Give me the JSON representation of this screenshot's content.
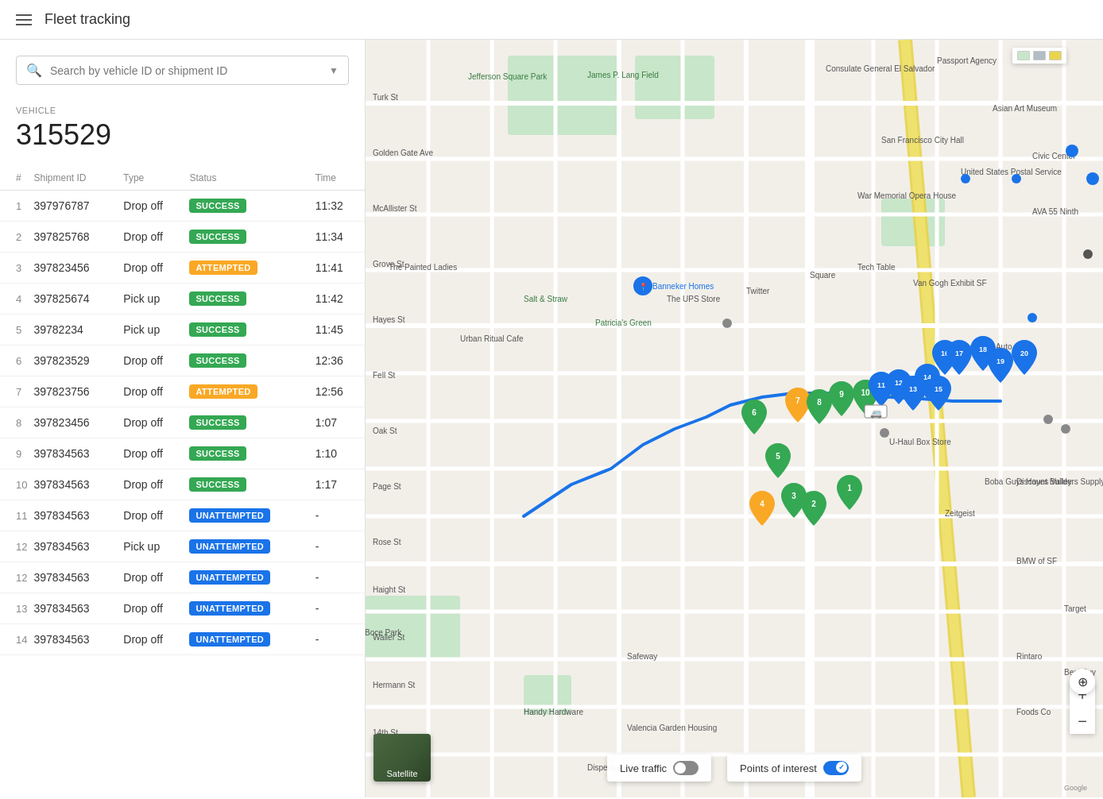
{
  "header": {
    "title": "Fleet tracking",
    "menu_icon_label": "Menu"
  },
  "search": {
    "placeholder": "Search by vehicle ID or shipment ID"
  },
  "vehicle": {
    "label": "VEHICLE",
    "id": "315529"
  },
  "table": {
    "columns": [
      "#",
      "Shipment ID",
      "Type",
      "Status",
      "Time"
    ],
    "rows": [
      {
        "num": 1,
        "shipment_id": "397976787",
        "type": "Drop off",
        "status": "SUCCESS",
        "time": "11:32"
      },
      {
        "num": 2,
        "shipment_id": "397825768",
        "type": "Drop off",
        "status": "SUCCESS",
        "time": "11:34"
      },
      {
        "num": 3,
        "shipment_id": "397823456",
        "type": "Drop off",
        "status": "ATTEMPTED",
        "time": "11:41"
      },
      {
        "num": 4,
        "shipment_id": "397825674",
        "type": "Pick up",
        "status": "SUCCESS",
        "time": "11:42"
      },
      {
        "num": 5,
        "shipment_id": "39782234",
        "type": "Pick up",
        "status": "SUCCESS",
        "time": "11:45"
      },
      {
        "num": 6,
        "shipment_id": "397823529",
        "type": "Drop off",
        "status": "SUCCESS",
        "time": "12:36"
      },
      {
        "num": 7,
        "shipment_id": "397823756",
        "type": "Drop off",
        "status": "ATTEMPTED",
        "time": "12:56"
      },
      {
        "num": 8,
        "shipment_id": "397823456",
        "type": "Drop off",
        "status": "SUCCESS",
        "time": "1:07"
      },
      {
        "num": 9,
        "shipment_id": "397834563",
        "type": "Drop off",
        "status": "SUCCESS",
        "time": "1:10"
      },
      {
        "num": 10,
        "shipment_id": "397834563",
        "type": "Drop off",
        "status": "SUCCESS",
        "time": "1:17"
      },
      {
        "num": 11,
        "shipment_id": "397834563",
        "type": "Drop off",
        "status": "UNATTEMPTED",
        "time": "-"
      },
      {
        "num": 12,
        "shipment_id": "397834563",
        "type": "Pick up",
        "status": "UNATTEMPTED",
        "time": "-"
      },
      {
        "num": 12,
        "shipment_id": "397834563",
        "type": "Drop off",
        "status": "UNATTEMPTED",
        "time": "-"
      },
      {
        "num": 13,
        "shipment_id": "397834563",
        "type": "Drop off",
        "status": "UNATTEMPTED",
        "time": "-"
      },
      {
        "num": 14,
        "shipment_id": "397834563",
        "type": "Drop off",
        "status": "UNATTEMPTED",
        "time": "-"
      }
    ]
  },
  "map": {
    "live_traffic_label": "Live traffic",
    "points_of_interest_label": "Points of interest",
    "satellite_label": "Satellite",
    "zoom_in_label": "+",
    "zoom_out_label": "−"
  },
  "status_colors": {
    "SUCCESS": "#34a853",
    "ATTEMPTED": "#f9a825",
    "UNATTEMPTED": "#1a73e8"
  }
}
